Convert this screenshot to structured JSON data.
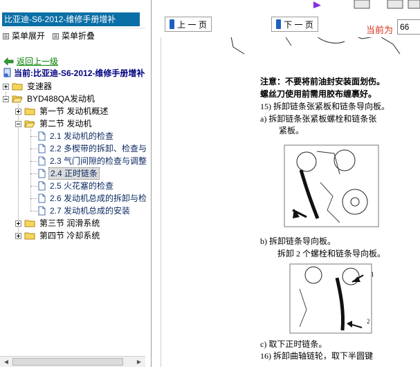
{
  "sidebar": {
    "title": "比亚迪-S6-2012-维修手册增补",
    "expand_all": "菜单展开",
    "collapse_all": "菜单折叠",
    "back": "返回上一级",
    "current": "当前:比亚迪-S6-2012-维修手册增补",
    "tree": {
      "transmission": "变速器",
      "engine": "BYD488QA发动机",
      "section1": "第一节 发动机概述",
      "section2": "第二节 发动机",
      "items": [
        "2.1 发动机的检查",
        "2.2 多楔带的拆卸、检查与",
        "2.3 气门间隙的检查与调整",
        "2.4 正时链条",
        "2.5 火花塞的检查",
        "2.6 发动机总成的拆卸与检",
        "2.7 发动机总成的安装"
      ],
      "section3": "第三节 润滑系统",
      "section4": "第四节 冷却系统"
    }
  },
  "toolbar": {
    "prev_label": "上 一 页",
    "next_label": "下 一 页",
    "current_page_label": "当前为",
    "page_value": "66"
  },
  "document": {
    "note1": "注意：不要将前油封安装面划伤。",
    "note2": "螺丝刀使用前需用胶布缠裹好。",
    "step15": "15)  拆卸链条张紧板和链条导向板。",
    "step_a1": "a)   拆卸链条张紧板螺栓和链条张",
    "step_a2": "紧板。",
    "step_b1": "b)   拆卸链条导向板。",
    "step_b2": "拆卸 2 个螺栓和链条导向板。",
    "fig_callout_1": "1",
    "fig_callout_2": "2",
    "step_c": "c)   取下正时链条。",
    "step16": "16)  拆卸曲轴链轮，取下半圆键"
  },
  "icons": {
    "back": "green-left-arrow-icon",
    "current": "document-icon",
    "nav_prev": "blue-arrow-icon",
    "nav_next": "blue-arrow-icon"
  },
  "colors": {
    "title_bar": "#0a6fa6",
    "back_link": "#008000",
    "current_text": "#000080",
    "page_label": "#d6301e",
    "nav_arrow": "#1f5fbf"
  }
}
